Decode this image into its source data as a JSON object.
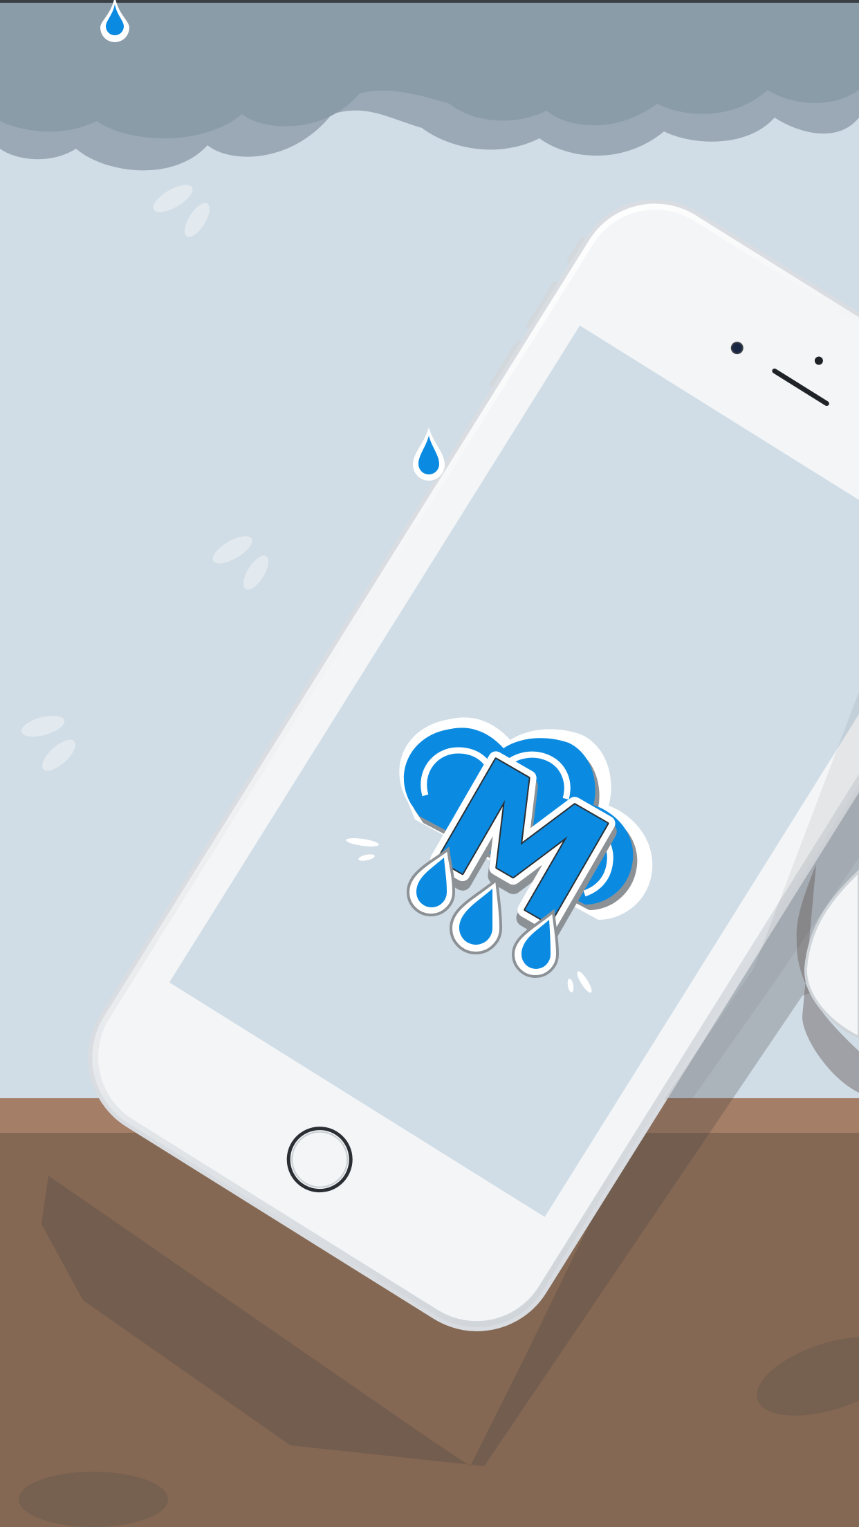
{
  "scene": {
    "kind": "app-promo-illustration",
    "colors": {
      "sky": "#d0dde6",
      "cloud_dark": "#8b9ca9",
      "cloud_light": "#9aa9b5",
      "ground_top": "#a47e66",
      "ground": "#846854",
      "ground_spot": "#76604f",
      "phone_body": "#f3f5f7",
      "phone_edge": "#d9dde1",
      "phone_screen": "#d0dde6",
      "phone_shadow": "#3f3a3a",
      "accent_blue": "#0a8ae0",
      "logo_shadow": "#8c9196",
      "white": "#ffffff"
    },
    "icons": [
      "storm-cloud-icon",
      "raindrop-icon",
      "splash-icon",
      "home-button-icon",
      "earpiece-icon",
      "front-camera-icon",
      "sensor-icon"
    ],
    "app_logo": {
      "letter": "M",
      "icon": "rain-cloud-logo-icon"
    }
  }
}
